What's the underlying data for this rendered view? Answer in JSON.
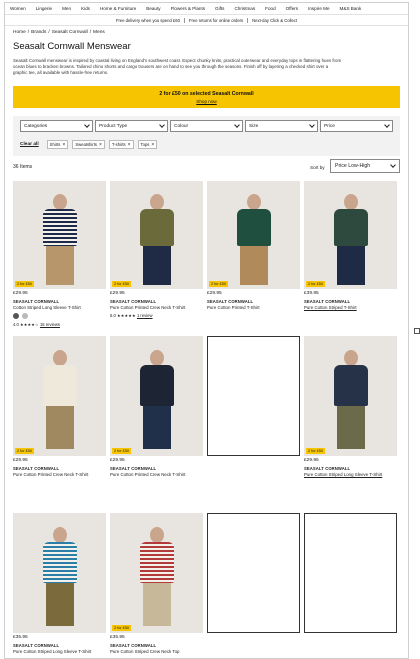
{
  "nav": [
    "Women",
    "Lingerie",
    "Men",
    "Kids",
    "Home & Furniture",
    "Beauty",
    "Flowers & Plants",
    "Gifts",
    "Christmas",
    "Food",
    "Offers",
    "Inspire Me",
    "M&S Bank"
  ],
  "promos": [
    "Free delivery when you spend £60",
    "Free returns for online orders",
    "Next-day Click & Collect"
  ],
  "breadcrumb": [
    "Home",
    "Brands",
    "Seasalt Cornwall",
    "Mens"
  ],
  "title": "Seasalt Cornwall Menswear",
  "description": "Seasalt Cornwall menswear is inspired by coastal living on England's southwest coast. Expect chunky knits, practical outerwear and everyday tops in flattering hues from ocean blues to bracken browns. Tailored chino shorts and cargo trousers are on hand to see you through the seasons. Finish off by layering a checked shirt over a graphic tee, all available with hassle-free returns.",
  "banner": {
    "headline": "2 for £50 on selected Seasalt Cornwall",
    "link": "Shop now"
  },
  "filters": [
    "Categories",
    "Product Type",
    "Colour",
    "Size",
    "Price"
  ],
  "clear_all": "Clear all",
  "active_filters": [
    "Shirts",
    "Sweatshirts",
    "T-shirts",
    "Tops"
  ],
  "item_count": "36 Items",
  "sort": {
    "label": "Sort by",
    "value": "Price Low-High"
  },
  "products": [
    {
      "badge": "2 for £50",
      "price": "£29.95",
      "brand": "SEASALT CORNWALL",
      "name": "Cotton Striped Long Sleeve T-Shirt",
      "rating": "4.0",
      "reviews": "15 reviews",
      "stars": 4,
      "swatches": [
        "#555555",
        "#b9b9b9"
      ],
      "shirt": "stripe-navy",
      "pants": "#b8966c",
      "underline": false
    },
    {
      "badge": "2 for £50",
      "price": "£29.95",
      "brand": "SEASALT CORNWALL",
      "name": "Pure Cotton Printed Crew Neck T-Shirt",
      "rating": "5.0",
      "reviews": "1 review",
      "stars": 5,
      "swatches": [],
      "shirt": "#6b6a3a",
      "pants": "#1f2a44",
      "underline": false
    },
    {
      "badge": "2 for £50",
      "price": "£29.95",
      "brand": "SEASALT CORNWALL",
      "name": "Pure Cotton Printed T-Shirt",
      "rating": "",
      "reviews": "",
      "stars": 0,
      "swatches": [],
      "shirt": "#1f4f3e",
      "pants": "#b08a5a",
      "underline": false
    },
    {
      "badge": "2 for £50",
      "price": "£39.95",
      "brand": "SEASALT CORNWALL",
      "name": "Pure Cotton Striped T-Shirt",
      "rating": "",
      "reviews": "",
      "stars": 0,
      "swatches": [],
      "shirt": "#2e4a3e",
      "pants": "#1f2a44",
      "underline": true
    },
    {
      "badge": "2 for £50",
      "price": "£29.95",
      "brand": "SEASALT CORNWALL",
      "name": "Pure Cotton Printed Crew Neck T-Shirt",
      "rating": "",
      "reviews": "",
      "stars": 0,
      "swatches": [],
      "shirt": "#efe9dc",
      "pants": "#a08860",
      "underline": false
    },
    {
      "badge": "2 for £50",
      "price": "£29.95",
      "brand": "SEASALT CORNWALL",
      "name": "Pure Cotton Printed Crew Neck T-Shirt",
      "rating": "",
      "reviews": "",
      "stars": 0,
      "swatches": [],
      "shirt": "#1d2433",
      "pants": "#20304a",
      "underline": false
    },
    {
      "empty": true
    },
    {
      "badge": "2 for £50",
      "price": "£29.95",
      "brand": "SEASALT CORNWALL",
      "name": "Pure Cotton Striped Long Sleeve T-Shirt",
      "rating": "",
      "reviews": "",
      "stars": 0,
      "swatches": [],
      "shirt": "#263247",
      "pants": "#6b6b4a",
      "underline": true
    },
    {
      "badge": "",
      "price": "£35.95",
      "brand": "SEASALT CORNWALL",
      "name": "Pure Cotton Striped Long Sleeve T-Shirt",
      "rating": "",
      "reviews": "",
      "stars": 0,
      "swatches": [],
      "shirt": "stripe-blue",
      "pants": "#7a6a3c",
      "underline": false
    },
    {
      "badge": "2 for £50",
      "price": "£35.95",
      "brand": "SEASALT CORNWALL",
      "name": "Pure Cotton Striped Crew Neck Top",
      "rating": "",
      "reviews": "",
      "stars": 0,
      "swatches": [],
      "shirt": "stripe-red",
      "pants": "#c8b89a",
      "underline": false
    },
    {
      "empty": true
    },
    {
      "empty": true
    }
  ]
}
